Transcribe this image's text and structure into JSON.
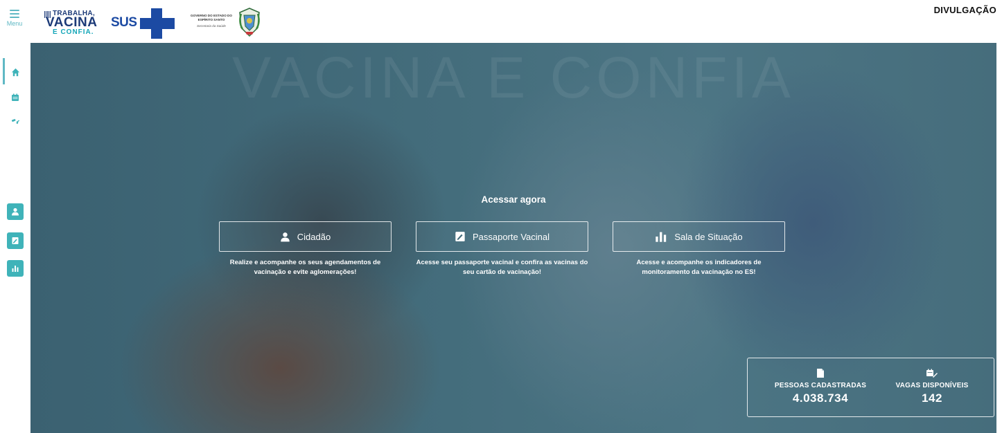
{
  "header": {
    "menu_label": "Menu",
    "logo_line1": "TRABALHA,",
    "logo_line2": "VACINA",
    "logo_line3": "E CONFIA.",
    "sus_text": "SUS",
    "gov_text": "GOVERNO DO ESTADO DO ESPÍRITO SANTO",
    "gov_sub": "Secretaria da Saúde",
    "tag": "DIVULGAÇÃO"
  },
  "sidebar": {
    "items": [
      {
        "icon": "home-icon",
        "active": true
      },
      {
        "icon": "calendar-icon",
        "active": false
      },
      {
        "icon": "vaccine-icon",
        "active": false
      },
      {
        "icon": "user-icon",
        "active": false
      },
      {
        "icon": "passport-icon",
        "active": false
      },
      {
        "icon": "chart-icon",
        "active": false
      }
    ]
  },
  "hero": {
    "watermark": "VACINA E CONFIA",
    "heading": "Acessar agora",
    "buttons": [
      {
        "label": "Cidadão",
        "icon": "user-icon",
        "description": "Realize e acompanhe os seus agendamentos de vacinação e evite aglomerações!"
      },
      {
        "label": "Passaporte Vacinal",
        "icon": "passport-icon",
        "description": "Acesse seu passaporte vacinal e confira as vacinas do seu cartão de vacinação!"
      },
      {
        "label": "Sala de Situação",
        "icon": "chart-icon",
        "description": "Acesse e acompanhe os indicadores de monitoramento da vacinação no ES!"
      }
    ],
    "stats": [
      {
        "label": "PESSOAS CADASTRADAS",
        "value": "4.038.734",
        "icon": "document-icon"
      },
      {
        "label": "VAGAS DISPONÍVEIS",
        "value": "142",
        "icon": "calendar-syringe-icon"
      }
    ]
  },
  "colors": {
    "accent": "#3fb3b9",
    "navy": "#1c3a78",
    "overlay": "#436c7b"
  }
}
